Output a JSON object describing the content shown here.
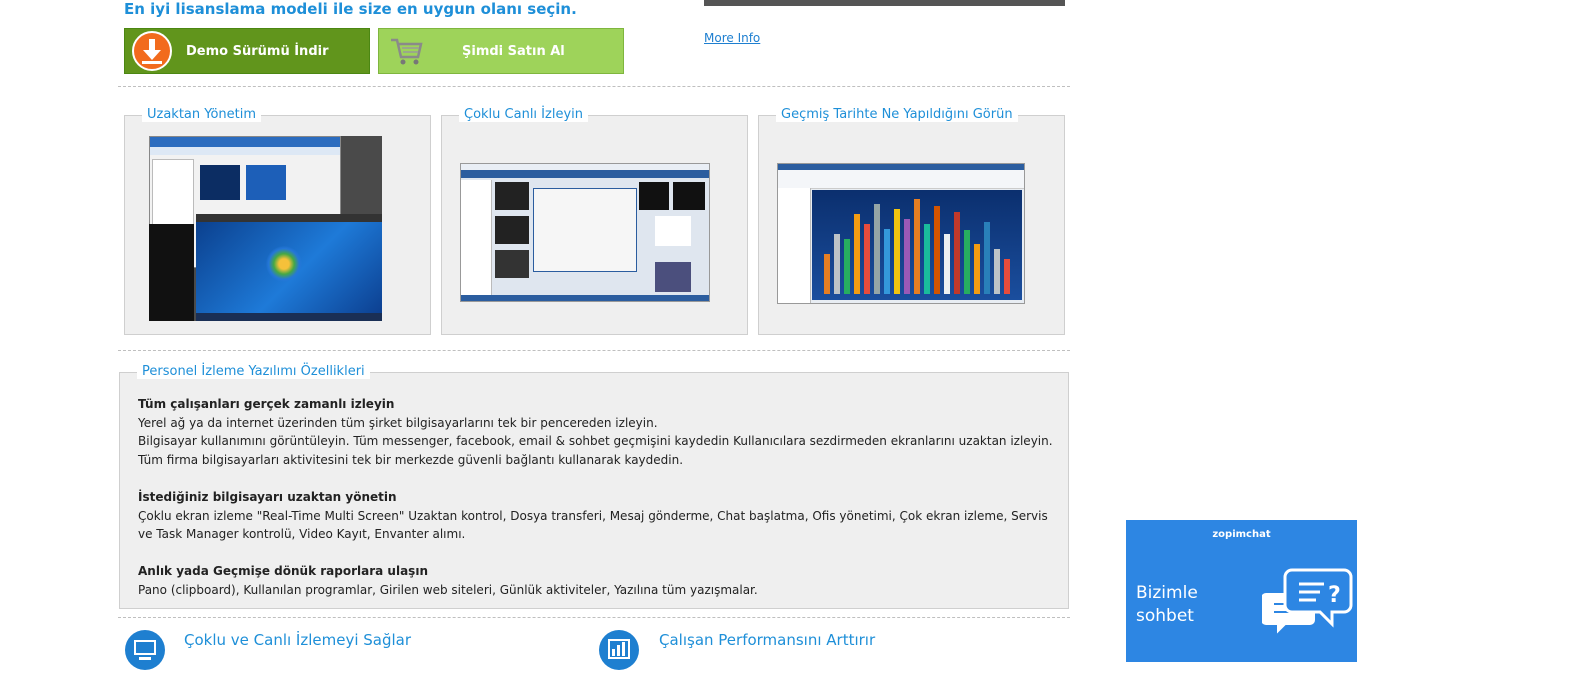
{
  "header": {
    "headline": "En iyi lisanslama modeli ile size en uygun olanı seçin.",
    "demo_button": "Demo Sürümü İndir",
    "buy_button": "Şimdi Satın Al",
    "more_info": "More Info"
  },
  "cards": [
    {
      "title": "Uzaktan Yönetim"
    },
    {
      "title": "Çoklu Canlı İzleyin"
    },
    {
      "title": "Geçmiş Tarihte Ne Yapıldığını Görün"
    }
  ],
  "features": {
    "title": "Personel İzleme Yazılımı Özellikleri",
    "sections": [
      {
        "heading": "Tüm çalışanları gerçek zamanlı izleyin",
        "lines": [
          "Yerel ağ ya da internet üzerinden tüm şirket bilgisayarlarını tek bir pencereden izleyin.",
          "Bilgisayar kullanımını görüntüleyin. Tüm messenger, facebook, email & sohbet geçmişini kaydedin Kullanıcılara sezdirmeden ekranlarını uzaktan izleyin.",
          "Tüm firma bilgisayarları aktivitesini tek bir merkezde güvenli bağlantı kullanarak kaydedin."
        ]
      },
      {
        "heading": "İstediğiniz bilgisayarı uzaktan yönetin",
        "lines": [
          "Çoklu ekran izleme \"Real-Time Multi Screen\" Uzaktan kontrol, Dosya transferi, Mesaj gönderme, Chat başlatma, Ofis yönetimi, Çok ekran izleme, Servis ve Task Manager kontrolü, Video Kayıt, Envanter alımı."
        ]
      },
      {
        "heading": "Anlık yada Geçmişe dönük raporlara ulaşın",
        "lines": [
          "Pano (clipboard), Kullanılan programlar, Girilen web siteleri, Günlük aktiviteler, Yazılına tüm yazışmalar."
        ]
      }
    ]
  },
  "bottom": {
    "link1": "Çoklu ve Canlı İzlemeyi Sağlar",
    "link2": "Çalışan Performansını Arttırır"
  },
  "chat": {
    "brand": "zopimchat",
    "line1": "Bizimle",
    "line2": "sohbet"
  }
}
